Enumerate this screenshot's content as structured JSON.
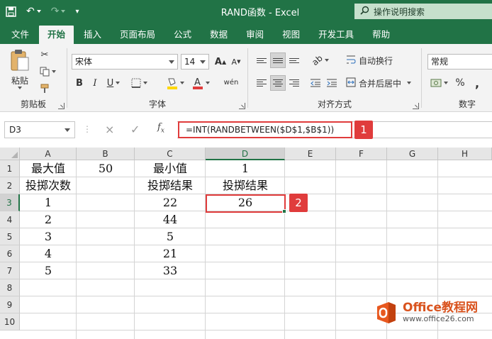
{
  "window": {
    "title": "RAND函数 - Excel",
    "tell_me": "操作说明搜索"
  },
  "tabs": [
    "文件",
    "开始",
    "插入",
    "页面布局",
    "公式",
    "数据",
    "审阅",
    "视图",
    "开发工具",
    "帮助"
  ],
  "active_tab": "开始",
  "ribbon": {
    "clipboard": {
      "paste_label": "粘贴",
      "group_label": "剪贴板"
    },
    "font": {
      "font_name": "宋体",
      "font_size": "14",
      "group_label": "字体",
      "bold": "B",
      "italic": "I",
      "underline": "U",
      "wen": "wén",
      "grow": "A",
      "shrink": "A"
    },
    "alignment": {
      "wrap_text": "自动换行",
      "merge_center": "合并后居中",
      "group_label": "对齐方式"
    },
    "number": {
      "format": "常规",
      "percent": "%",
      "comma": ",",
      "group_label": "数字"
    },
    "colors": {
      "accent": "#217346",
      "highlight": "#ffd700",
      "font_color": "#e03c3c",
      "callout": "#e03c3c"
    }
  },
  "formula_bar": {
    "name_box": "D3",
    "formula": "=INT(RANDBETWEEN($D$1,$B$1))",
    "fx": "fx",
    "cancel_icon": "×",
    "enter_icon": "✓",
    "callout_1": "1"
  },
  "sheet": {
    "columns": [
      "A",
      "B",
      "C",
      "D",
      "E",
      "F",
      "G",
      "H"
    ],
    "rows": [
      "1",
      "2",
      "3",
      "4",
      "5",
      "6",
      "7",
      "8",
      "9",
      "10"
    ],
    "selected_cell": "D3",
    "cells": {
      "A1": "最大值",
      "B1": "50",
      "C1": "最小值",
      "D1": "1",
      "A2": "投掷次数",
      "C2": "投掷结果",
      "D2": "投掷结果",
      "A3": "1",
      "C3": "22",
      "D3": "26",
      "A4": "2",
      "C4": "44",
      "A5": "3",
      "C5": "5",
      "A6": "4",
      "C6": "21",
      "A7": "5",
      "C7": "33"
    },
    "callout_2": "2"
  },
  "watermark": {
    "brand": "Office教程网",
    "url": "www.office26.com"
  }
}
